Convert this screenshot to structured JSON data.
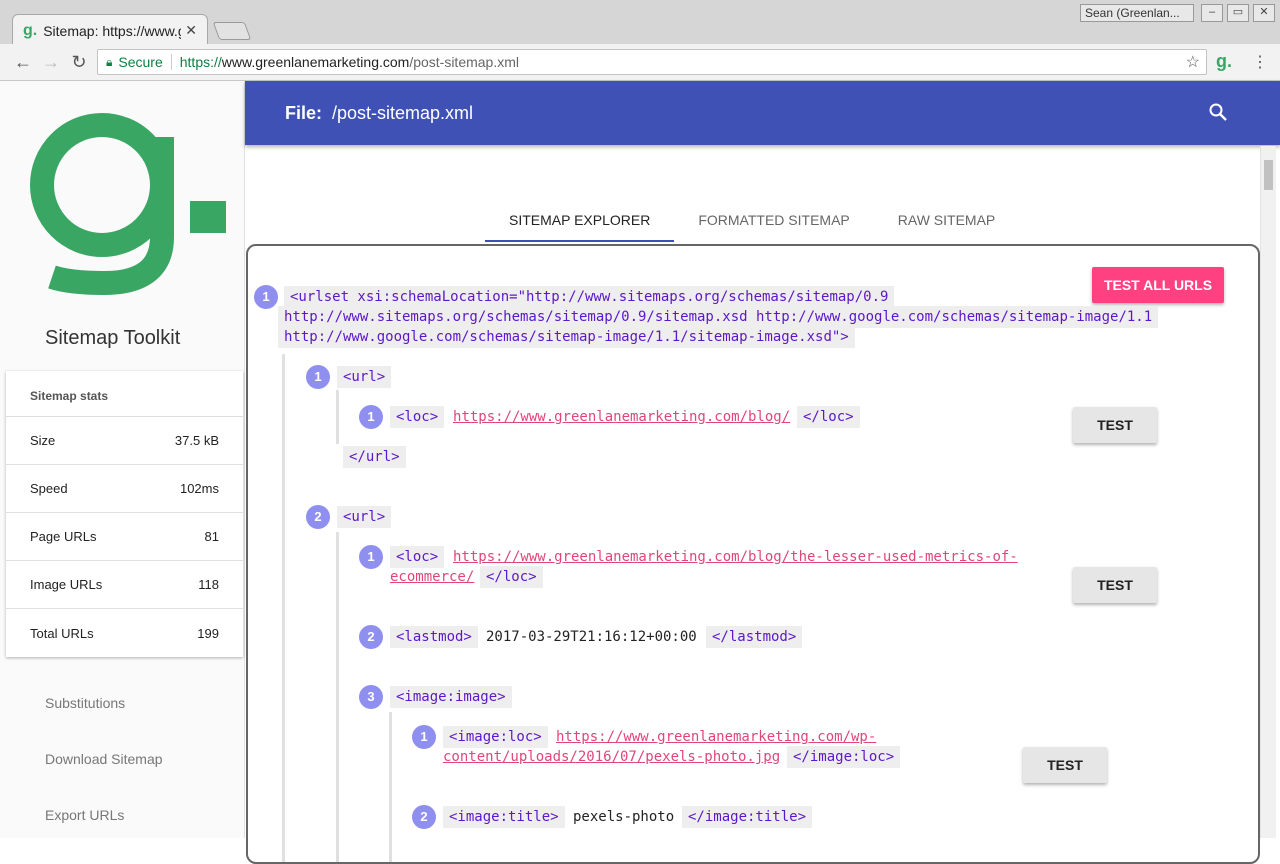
{
  "browser": {
    "tab_title": "Sitemap: https://www.greenlanemarketing.com/post-sitemap.xml",
    "user": "Sean (Greenlan...",
    "secure": "Secure",
    "url_scheme": "https://",
    "url_host": "www.greenlanemarketing.com",
    "url_path": "/post-sitemap.xml"
  },
  "sidebar": {
    "app_name": "Sitemap Toolkit",
    "stats_title": "Sitemap stats",
    "stats": [
      {
        "label": "Size",
        "value": "37.5 kB"
      },
      {
        "label": "Speed",
        "value": "102ms"
      },
      {
        "label": "Page URLs",
        "value": "81"
      },
      {
        "label": "Image URLs",
        "value": "118"
      },
      {
        "label": "Total URLs",
        "value": "199"
      }
    ],
    "links": [
      "Substitutions",
      "Download Sitemap",
      "Export URLs"
    ]
  },
  "header": {
    "file_label": "File:",
    "file_name": "/post-sitemap.xml"
  },
  "tabs": [
    "Sitemap Explorer",
    "Formatted Sitemap",
    "Raw Sitemap"
  ],
  "explorer": {
    "test_all": "TEST ALL URLS",
    "test": "TEST",
    "urlset_line1": "<urlset xsi:schemaLocation=\"http://www.sitemaps.org/schemas/sitemap/0.9",
    "urlset_line2": "http://www.sitemaps.org/schemas/sitemap/0.9/sitemap.xsd http://www.google.com/schemas/sitemap-image/1.1",
    "urlset_line3": "http://www.google.com/schemas/sitemap-image/1.1/sitemap-image.xsd\">",
    "url_open": "<url>",
    "url_close": "</url>",
    "loc_open": "<loc>",
    "loc_close": "</loc>",
    "lastmod_open": "<lastmod>",
    "lastmod_close": "</lastmod>",
    "image_open": "<image:image>",
    "imgloc_open": "<image:loc>",
    "imgloc_close": "</image:loc>",
    "imgtitle_open": "<image:title>",
    "imgtitle_close": "</image:title>",
    "url1_loc": "https://www.greenlanemarketing.com/blog/",
    "url2_loc_a": "https://www.greenlanemarketing.com/blog/the-lesser-used-metrics-of-",
    "url2_loc_b": "ecommerce/",
    "url2_lastmod": "2017-03-29T21:16:12+00:00",
    "img_loc_a": "https://www.greenlanemarketing.com/wp-",
    "img_loc_b": "content/uploads/2016/07/pexels-photo.jpg",
    "img_title": "pexels-photo",
    "n1": "1",
    "n2": "2",
    "n3": "3"
  }
}
